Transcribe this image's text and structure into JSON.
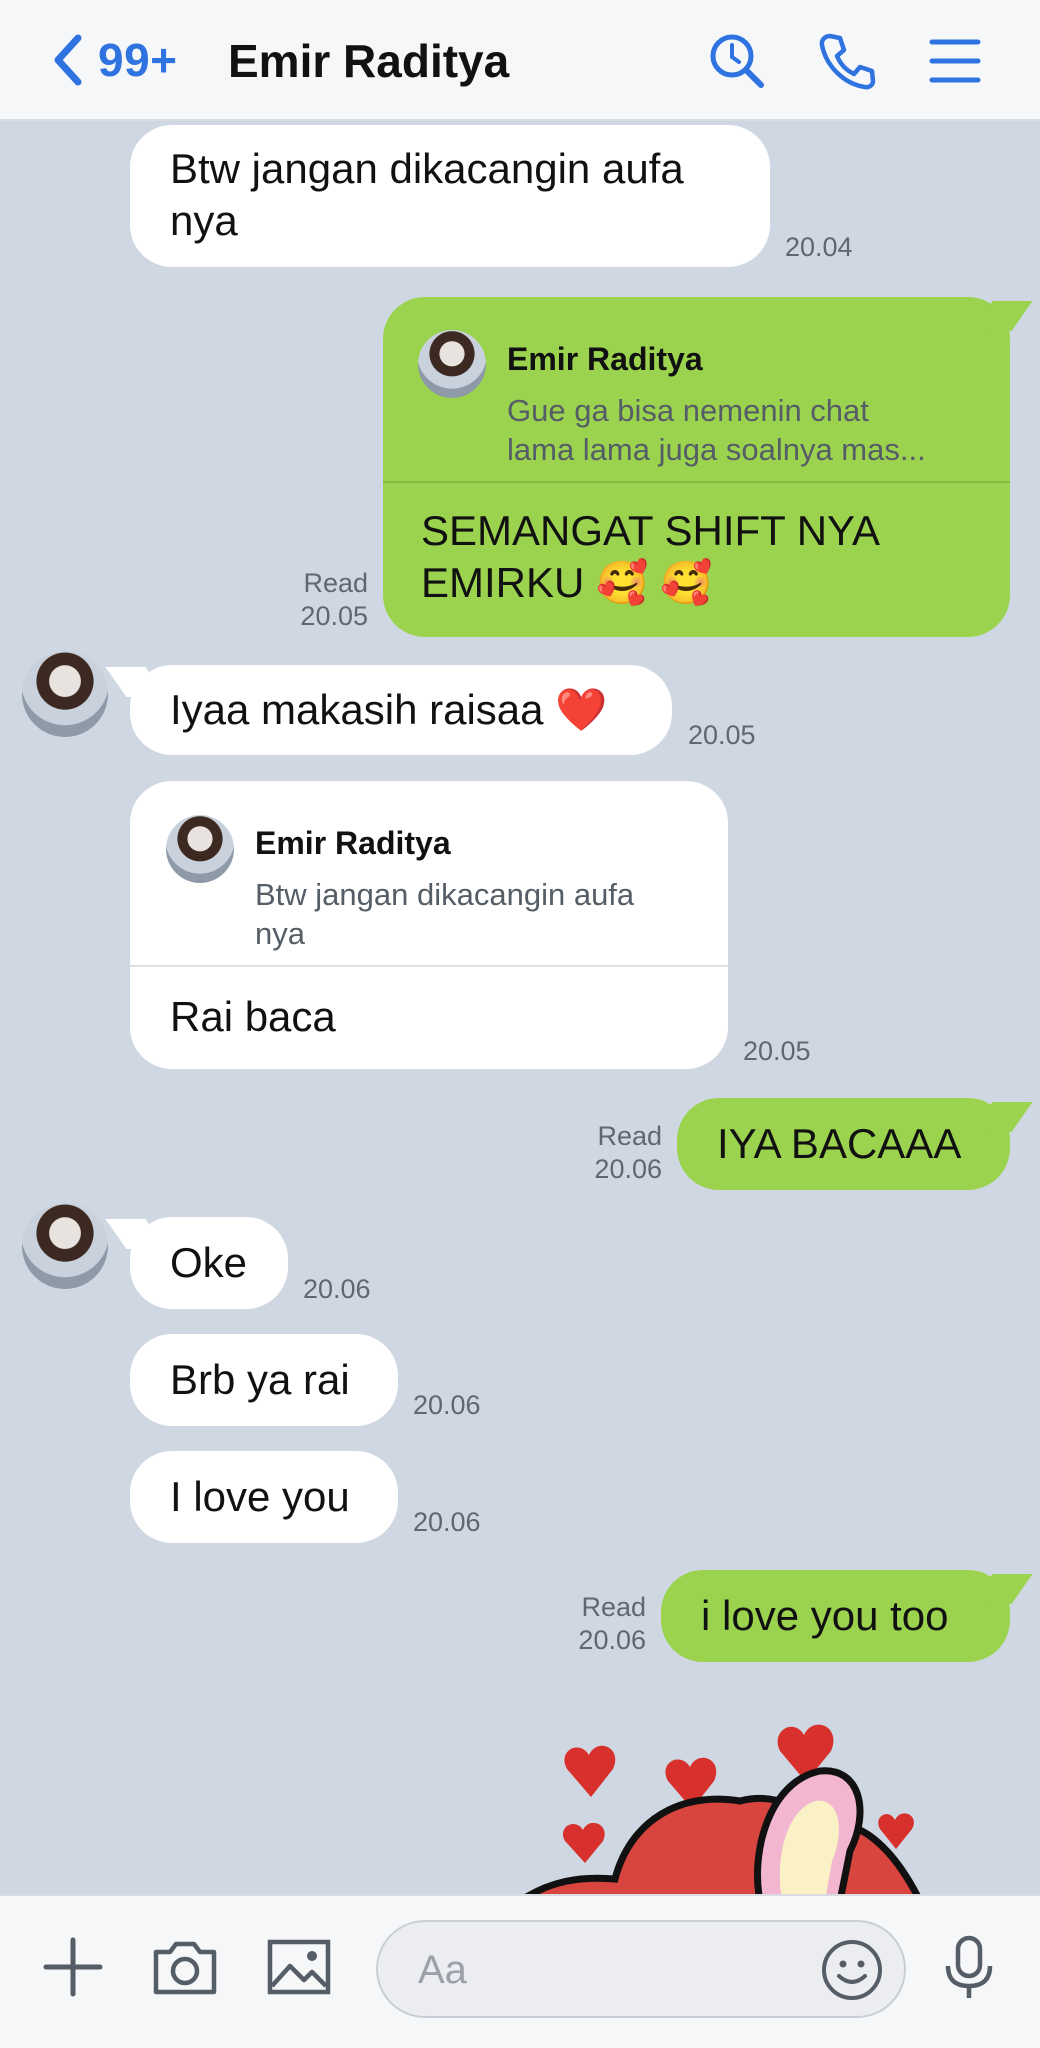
{
  "header": {
    "unread_count": "99+",
    "contact_name": "Emir Raditya"
  },
  "messages": [
    {
      "text": "Btw jangan dikacangin aufa nya",
      "line1": "Btw jangan dikacangin aufa",
      "line2": "nya",
      "time": "20.04"
    },
    {
      "quote_name": "Emir Raditya",
      "quote_line1": "Gue ga bisa nemenin chat",
      "quote_line2": "lama lama juga soalnya mas...",
      "line1": "SEMANGAT SHIFT NYA",
      "line2": "EMIRKU 🥰 🥰",
      "read": "Read",
      "time": "20.05"
    },
    {
      "text": "Iyaa makasih raisaa ❤️",
      "time": "20.05"
    },
    {
      "quote_name": "Emir Raditya",
      "quote_line1": "Btw jangan dikacangin aufa",
      "quote_line2": "nya",
      "text": "Rai baca",
      "time": "20.05"
    },
    {
      "text": "IYA BACAAA",
      "read": "Read",
      "time": "20.06"
    },
    {
      "text": "Oke",
      "time": "20.06"
    },
    {
      "text": "Brb ya rai",
      "time": "20.06"
    },
    {
      "text": "I love you",
      "time": "20.06"
    },
    {
      "text": "i love you too",
      "read": "Read",
      "time": "20.06"
    }
  ],
  "composer": {
    "placeholder": "Aa"
  },
  "colors": {
    "accent": "#2f73e0",
    "outgoing_bubble": "#9bd34f",
    "incoming_bubble": "#ffffff",
    "chat_background": "#cfd8e2"
  }
}
